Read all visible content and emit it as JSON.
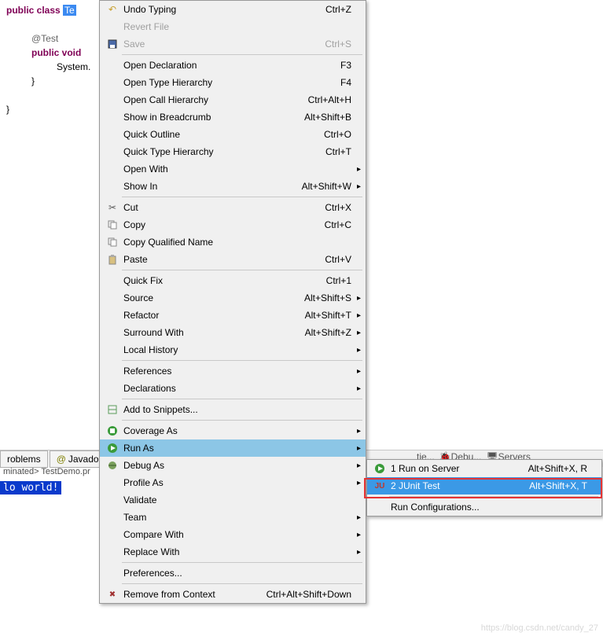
{
  "code": {
    "l1a": "public class ",
    "l1b": "Te",
    "l2": "@Test",
    "l3a": "public void",
    "l4": "System.",
    "brace1": "}",
    "brace2": "}"
  },
  "tabs": {
    "problems": "roblems",
    "javadoc": "Javadoc"
  },
  "status": "minated> TestDemo.pr",
  "console": "lo world!",
  "rightTabs": {
    "a": "tie...",
    "b": "Debu...",
    "c": "Servers"
  },
  "menu": [
    {
      "type": "item",
      "label": "Undo Typing",
      "shortcut": "Ctrl+Z",
      "icon": "undo"
    },
    {
      "type": "item",
      "label": "Revert File",
      "shortcut": "",
      "disabled": true
    },
    {
      "type": "item",
      "label": "Save",
      "shortcut": "Ctrl+S",
      "icon": "save",
      "disabled": true
    },
    {
      "type": "sep"
    },
    {
      "type": "item",
      "label": "Open Declaration",
      "shortcut": "F3"
    },
    {
      "type": "item",
      "label": "Open Type Hierarchy",
      "shortcut": "F4"
    },
    {
      "type": "item",
      "label": "Open Call Hierarchy",
      "shortcut": "Ctrl+Alt+H"
    },
    {
      "type": "item",
      "label": "Show in Breadcrumb",
      "shortcut": "Alt+Shift+B"
    },
    {
      "type": "item",
      "label": "Quick Outline",
      "shortcut": "Ctrl+O"
    },
    {
      "type": "item",
      "label": "Quick Type Hierarchy",
      "shortcut": "Ctrl+T"
    },
    {
      "type": "item",
      "label": "Open With",
      "shortcut": "",
      "sub": true
    },
    {
      "type": "item",
      "label": "Show In",
      "shortcut": "Alt+Shift+W",
      "sub": true
    },
    {
      "type": "sep"
    },
    {
      "type": "item",
      "label": "Cut",
      "shortcut": "Ctrl+X",
      "icon": "cut"
    },
    {
      "type": "item",
      "label": "Copy",
      "shortcut": "Ctrl+C",
      "icon": "copy"
    },
    {
      "type": "item",
      "label": "Copy Qualified Name",
      "shortcut": "",
      "icon": "copyq"
    },
    {
      "type": "item",
      "label": "Paste",
      "shortcut": "Ctrl+V",
      "icon": "paste"
    },
    {
      "type": "sep"
    },
    {
      "type": "item",
      "label": "Quick Fix",
      "shortcut": "Ctrl+1"
    },
    {
      "type": "item",
      "label": "Source",
      "shortcut": "Alt+Shift+S",
      "sub": true
    },
    {
      "type": "item",
      "label": "Refactor",
      "shortcut": "Alt+Shift+T",
      "sub": true
    },
    {
      "type": "item",
      "label": "Surround With",
      "shortcut": "Alt+Shift+Z",
      "sub": true
    },
    {
      "type": "item",
      "label": "Local History",
      "shortcut": "",
      "sub": true
    },
    {
      "type": "sep"
    },
    {
      "type": "item",
      "label": "References",
      "shortcut": "",
      "sub": true
    },
    {
      "type": "item",
      "label": "Declarations",
      "shortcut": "",
      "sub": true
    },
    {
      "type": "sep"
    },
    {
      "type": "item",
      "label": "Add to Snippets...",
      "shortcut": "",
      "icon": "snip"
    },
    {
      "type": "sep"
    },
    {
      "type": "item",
      "label": "Coverage As",
      "shortcut": "",
      "icon": "cov",
      "sub": true
    },
    {
      "type": "item",
      "label": "Run As",
      "shortcut": "",
      "icon": "run",
      "sub": true,
      "hl": true
    },
    {
      "type": "item",
      "label": "Debug As",
      "shortcut": "",
      "icon": "debug",
      "sub": true
    },
    {
      "type": "item",
      "label": "Profile As",
      "shortcut": "",
      "sub": true
    },
    {
      "type": "item",
      "label": "Validate",
      "shortcut": ""
    },
    {
      "type": "item",
      "label": "Team",
      "shortcut": "",
      "sub": true
    },
    {
      "type": "item",
      "label": "Compare With",
      "shortcut": "",
      "sub": true
    },
    {
      "type": "item",
      "label": "Replace With",
      "shortcut": "",
      "sub": true
    },
    {
      "type": "sep"
    },
    {
      "type": "item",
      "label": "Preferences...",
      "shortcut": ""
    },
    {
      "type": "sep"
    },
    {
      "type": "item",
      "label": "Remove from Context",
      "shortcut": "Ctrl+Alt+Shift+Down",
      "icon": "remove"
    }
  ],
  "submenu": [
    {
      "type": "item",
      "label": "1 Run on Server",
      "shortcut": "Alt+Shift+X, R",
      "icon": "server"
    },
    {
      "type": "item",
      "label": "2 JUnit Test",
      "shortcut": "Alt+Shift+X, T",
      "icon": "junit",
      "hl2": true
    },
    {
      "type": "sep"
    },
    {
      "type": "item",
      "label": "Run Configurations...",
      "shortcut": ""
    }
  ],
  "watermark": "https://blog.csdn.net/candy_27"
}
